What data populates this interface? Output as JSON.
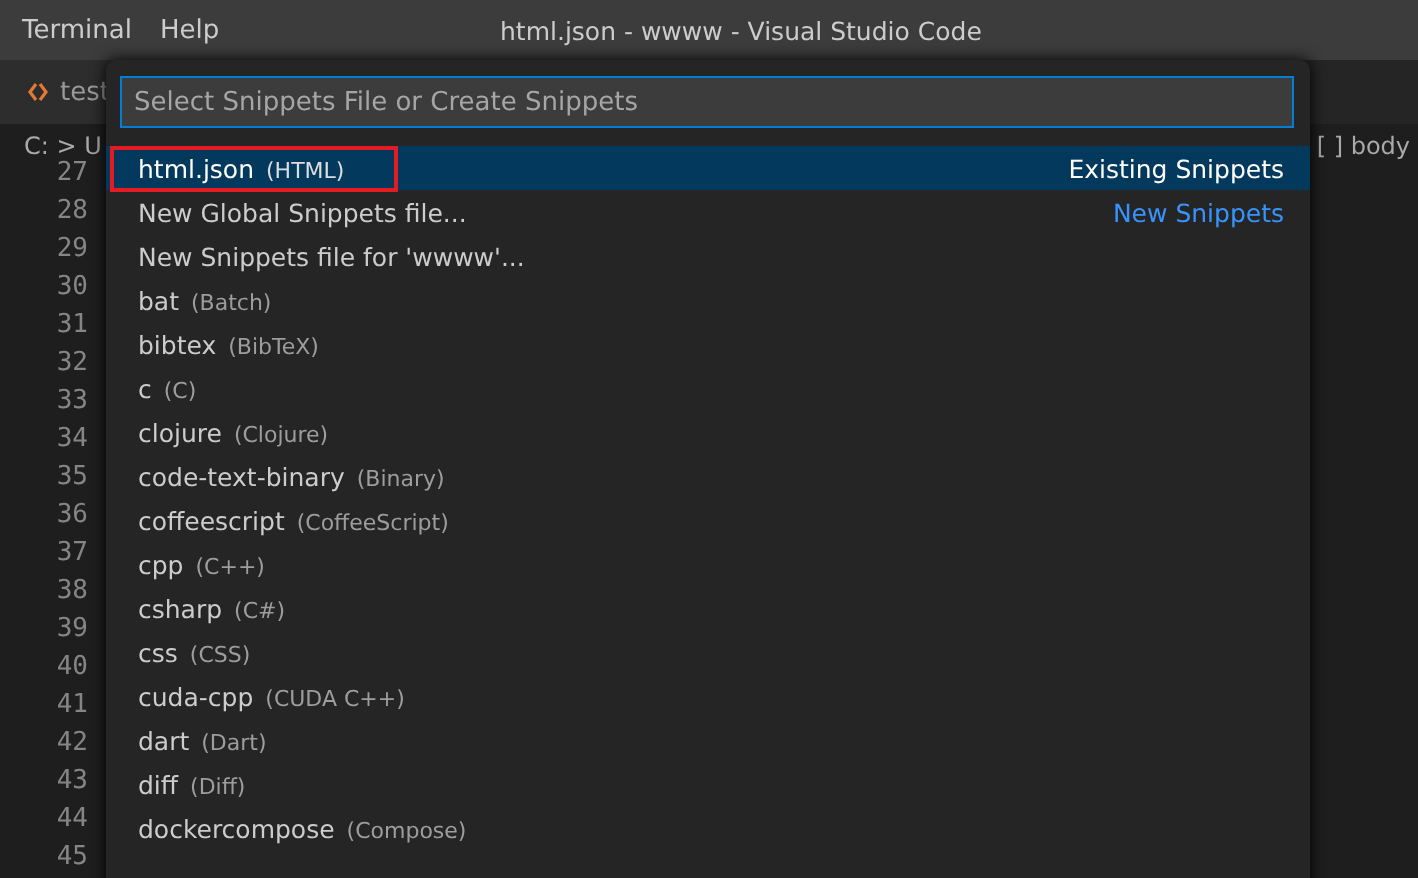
{
  "menu": [
    "Terminal",
    "Help"
  ],
  "window": {
    "title": "html.json - wwww - Visual Studio Code"
  },
  "tab": {
    "label": "test"
  },
  "breadcrumb": {
    "left": "C: > U",
    "right": "[ ] body"
  },
  "line_numbers": [
    "27",
    "28",
    "29",
    "30",
    "31",
    "32",
    "33",
    "34",
    "35",
    "36",
    "37",
    "38",
    "39",
    "40",
    "41",
    "42",
    "43",
    "44",
    "45"
  ],
  "quick_pick": {
    "placeholder": "Select Snippets File or Create Snippets",
    "items": [
      {
        "label": "html.json",
        "detail": "(HTML)",
        "description": "Existing Snippets",
        "selected": true,
        "highlighted": true
      },
      {
        "label": "New Global Snippets file...",
        "description": "New Snippets",
        "selected": false,
        "highlighted": false
      },
      {
        "label": "New Snippets file for 'wwww'...",
        "selected": false,
        "highlighted": false
      },
      {
        "label": "bat",
        "detail": "(Batch)",
        "selected": false,
        "highlighted": false
      },
      {
        "label": "bibtex",
        "detail": "(BibTeX)",
        "selected": false,
        "highlighted": false
      },
      {
        "label": "c",
        "detail": "(C)",
        "selected": false,
        "highlighted": false
      },
      {
        "label": "clojure",
        "detail": "(Clojure)",
        "selected": false,
        "highlighted": false
      },
      {
        "label": "code-text-binary",
        "detail": "(Binary)",
        "selected": false,
        "highlighted": false
      },
      {
        "label": "coffeescript",
        "detail": "(CoffeeScript)",
        "selected": false,
        "highlighted": false
      },
      {
        "label": "cpp",
        "detail": "(C++)",
        "selected": false,
        "highlighted": false
      },
      {
        "label": "csharp",
        "detail": "(C#)",
        "selected": false,
        "highlighted": false
      },
      {
        "label": "css",
        "detail": "(CSS)",
        "selected": false,
        "highlighted": false
      },
      {
        "label": "cuda-cpp",
        "detail": "(CUDA C++)",
        "selected": false,
        "highlighted": false
      },
      {
        "label": "dart",
        "detail": "(Dart)",
        "selected": false,
        "highlighted": false
      },
      {
        "label": "diff",
        "detail": "(Diff)",
        "selected": false,
        "highlighted": false
      },
      {
        "label": "dockercompose",
        "detail": "(Compose)",
        "selected": false,
        "highlighted": false
      }
    ]
  }
}
